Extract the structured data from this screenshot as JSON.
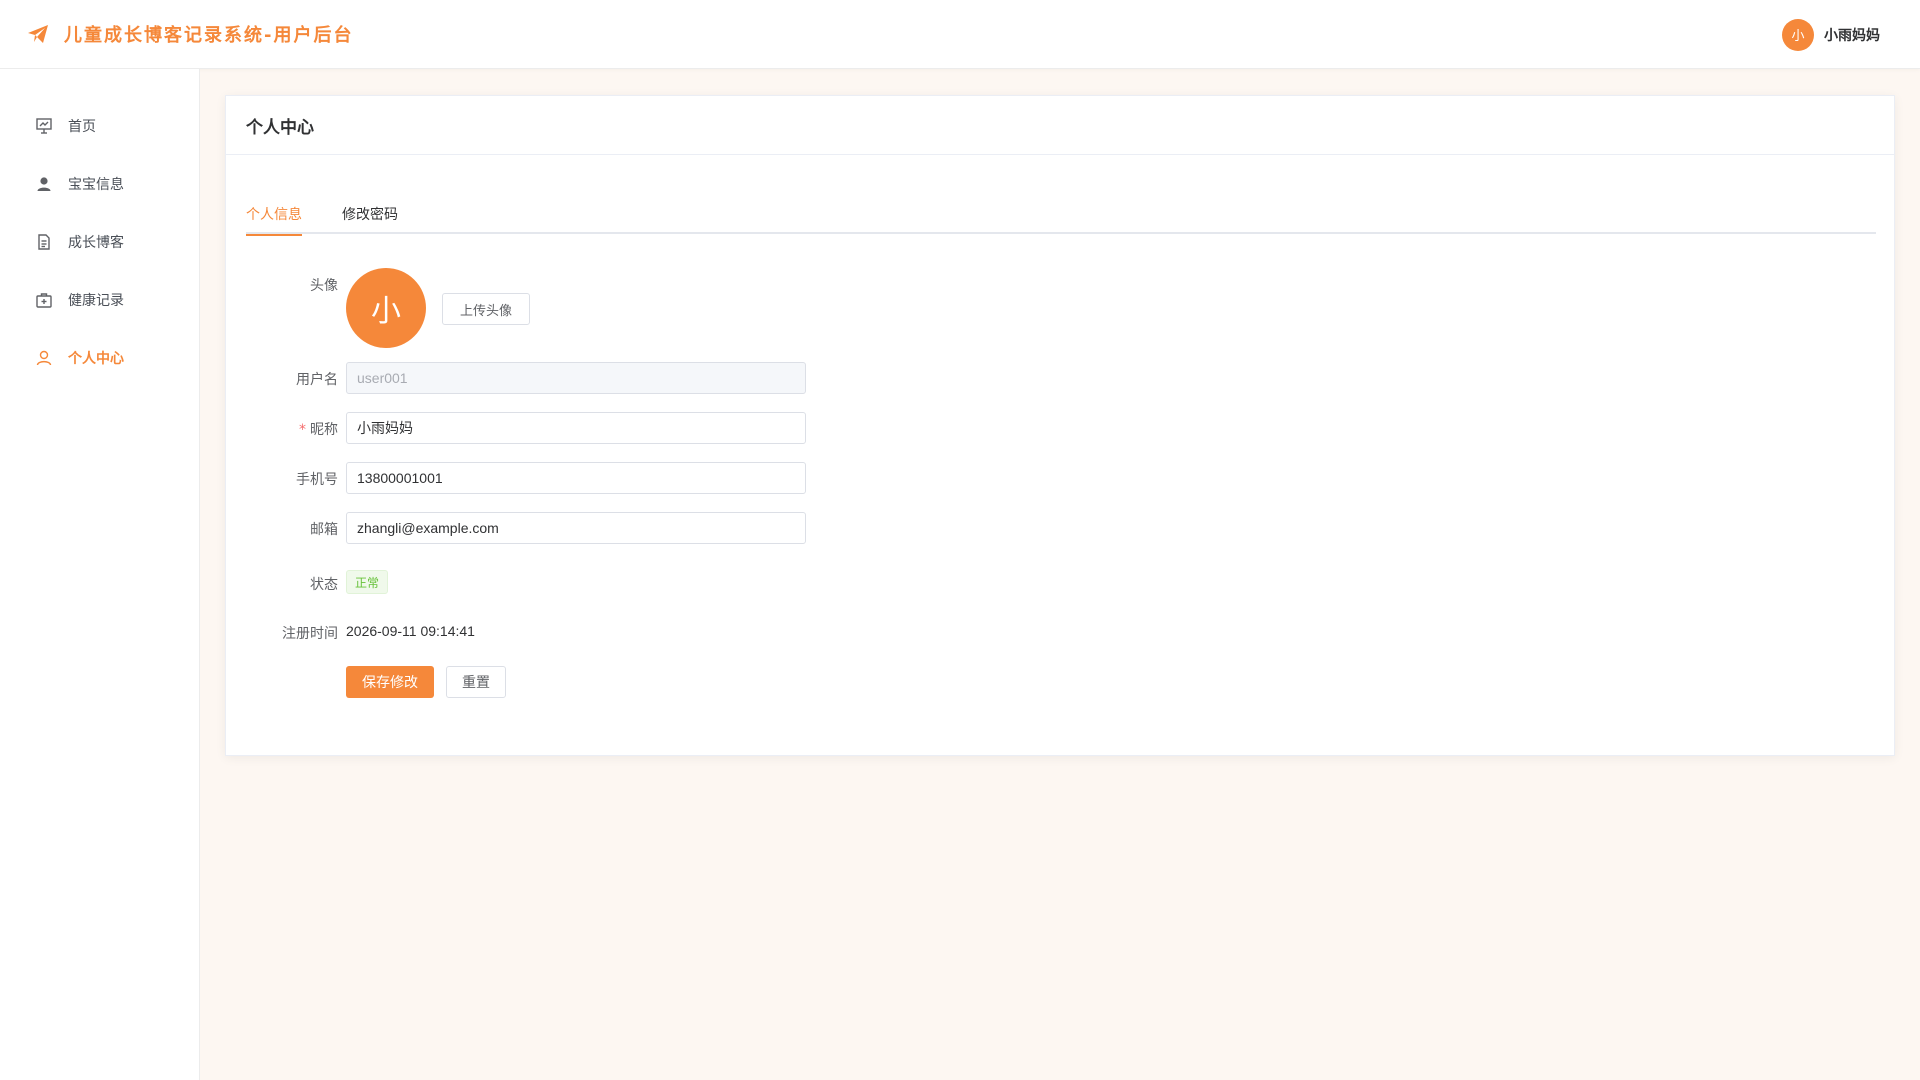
{
  "header": {
    "app_title": "儿童成长博客记录系统-用户后台",
    "user_avatar_text": "小",
    "user_name": "小雨妈妈"
  },
  "sidebar": {
    "items": [
      {
        "label": "首页",
        "icon": "chart-board-icon"
      },
      {
        "label": "宝宝信息",
        "icon": "user-icon"
      },
      {
        "label": "成长博客",
        "icon": "document-icon"
      },
      {
        "label": "健康记录",
        "icon": "medical-kit-icon"
      },
      {
        "label": "个人中心",
        "icon": "user-outline-icon",
        "active": true
      }
    ]
  },
  "main": {
    "title": "个人中心",
    "tabs": [
      {
        "label": "个人信息",
        "active": true
      },
      {
        "label": "修改密码",
        "active": false
      }
    ],
    "form": {
      "avatar_label": "头像",
      "avatar_text": "小",
      "upload_button": "上传头像",
      "username_label": "用户名",
      "username_value": "user001",
      "nickname_required_mark": "*",
      "nickname_label": "昵称",
      "nickname_value": "小雨妈妈",
      "phone_label": "手机号",
      "phone_value": "13800001001",
      "email_label": "邮箱",
      "email_value": "zhangli@example.com",
      "status_label": "状态",
      "status_value": "正常",
      "register_time_label": "注册时间",
      "register_time_value": "2026-09-11 09:14:41",
      "save_button": "保存修改",
      "reset_button": "重置"
    }
  },
  "colors": {
    "accent": "#f5883a",
    "success": "#67c23a",
    "danger": "#f56c6c",
    "background": "#fdf7f2"
  }
}
